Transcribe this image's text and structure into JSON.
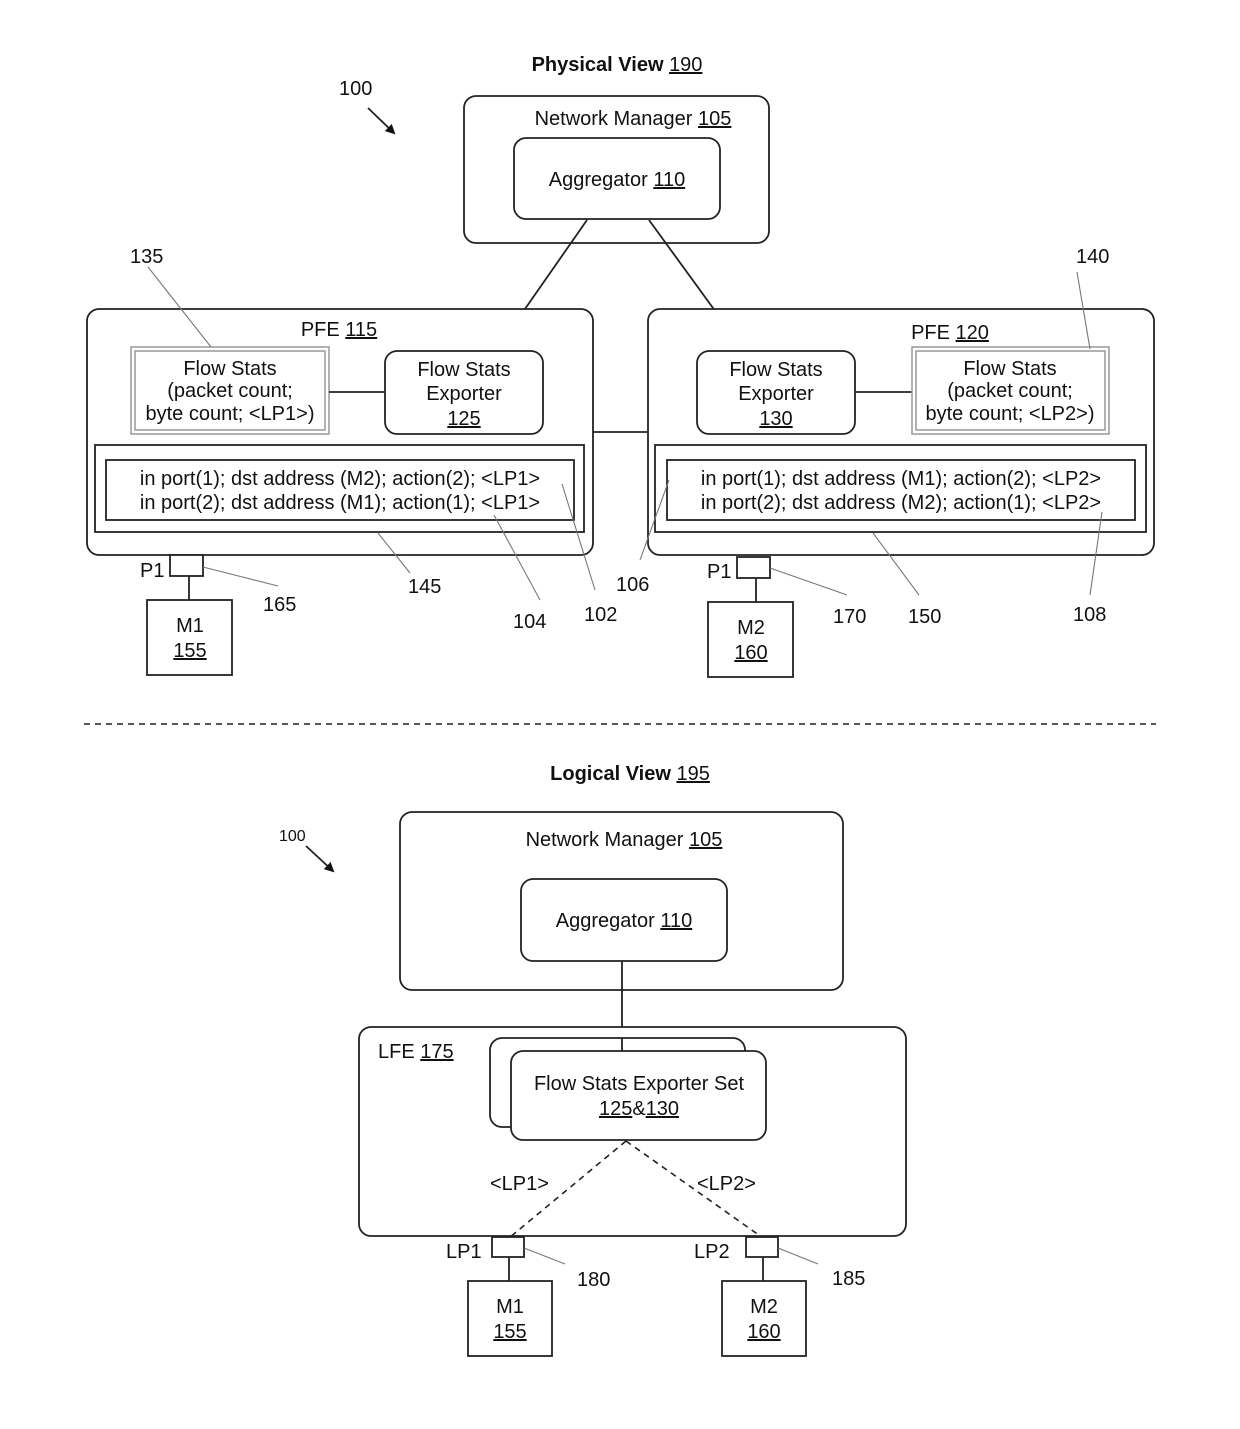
{
  "figure_number": "100",
  "physical_view": {
    "title": "Physical View",
    "ref": "190",
    "network_manager": {
      "label": "Network Manager",
      "ref": "105"
    },
    "aggregator": {
      "label": "Aggregator",
      "ref": "110"
    },
    "pfe_left": {
      "label": "PFE",
      "ref": "115",
      "flow_stats": {
        "line1": "Flow Stats",
        "line2": "(packet count;",
        "line3": "byte count; <LP1>)",
        "ref": "135"
      },
      "exporter": {
        "line1": "Flow Stats",
        "line2": "Exporter",
        "ref": "125"
      },
      "flow_table": {
        "ref": "145",
        "rows": [
          "in port(1); dst address (M2); action(2); <LP1>",
          "in port(2); dst address (M1); action(1); <LP1>"
        ],
        "row_refs": [
          "102",
          "104"
        ]
      },
      "port": {
        "label": "P1",
        "ref": "165"
      },
      "machine": {
        "label": "M1",
        "ref": "155"
      }
    },
    "pfe_right": {
      "label": "PFE",
      "ref": "120",
      "flow_stats": {
        "line1": "Flow Stats",
        "line2": "(packet count;",
        "line3": "byte count; <LP2>)",
        "ref": "140"
      },
      "exporter": {
        "line1": "Flow Stats",
        "line2": "Exporter",
        "ref": "130"
      },
      "flow_table": {
        "ref": "150",
        "rows": [
          "in port(1); dst address (M1); action(2); <LP2>",
          "in port(2); dst address (M2); action(1); <LP2>"
        ],
        "row_refs": [
          "106",
          "108"
        ]
      },
      "port": {
        "label": "P1",
        "ref": "170"
      },
      "machine": {
        "label": "M2",
        "ref": "160"
      }
    }
  },
  "logical_view": {
    "title": "Logical View",
    "ref": "195",
    "network_manager": {
      "label": "Network Manager",
      "ref": "105"
    },
    "aggregator": {
      "label": "Aggregator",
      "ref": "110"
    },
    "lfe": {
      "label": "LFE",
      "ref": "175"
    },
    "exporter_set": {
      "label": "Flow Stats Exporter Set",
      "ref_a": "125",
      "amp": "&",
      "ref_b": "130"
    },
    "link_labels": [
      "<LP1>",
      "<LP2>"
    ],
    "ports": [
      {
        "label": "LP1",
        "ref": "180"
      },
      {
        "label": "LP2",
        "ref": "185"
      }
    ],
    "machines": [
      {
        "label": "M1",
        "ref": "155"
      },
      {
        "label": "M2",
        "ref": "160"
      }
    ]
  }
}
